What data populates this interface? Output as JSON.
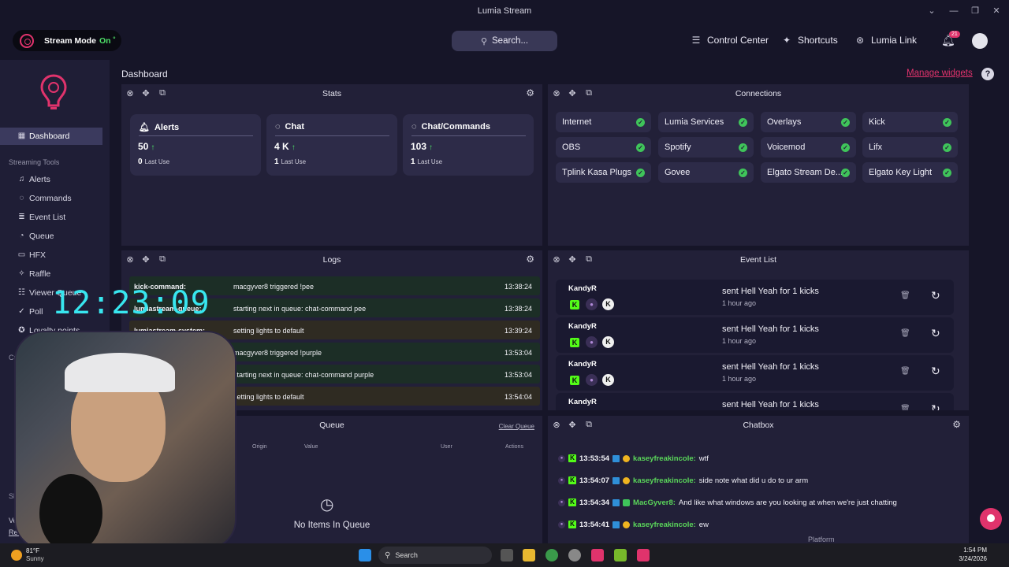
{
  "window": {
    "title": "Lumia Stream"
  },
  "topbar": {
    "stream_mode_label": "Stream Mode",
    "stream_mode_state": "On ˚",
    "search_placeholder": "Search...",
    "nav": [
      {
        "label": "Control Center",
        "icon": "sliders-icon"
      },
      {
        "label": "Shortcuts",
        "icon": "lightbulb-icon"
      },
      {
        "label": "Lumia Link",
        "icon": "link-icon"
      }
    ],
    "notifications_count": "21"
  },
  "sidebar": {
    "active": "Dashboard",
    "dashboard_label": "Dashboard",
    "section_streaming": "Streaming Tools",
    "items": [
      "Alerts",
      "Commands",
      "Event List",
      "Queue",
      "HFX",
      "Raffle",
      "Viewer Queue",
      "Poll",
      "Loyalty points"
    ],
    "section_creator": "Creator",
    "share_label": "Shar",
    "version_label": "Version:",
    "release_notes": "Release notes"
  },
  "main": {
    "title": "Dashboard",
    "manage_widgets": "Manage widgets",
    "help": "?"
  },
  "stats": {
    "title": "Stats",
    "cards": [
      {
        "name": "Alerts",
        "value": "50",
        "last_use_value": "0",
        "last_use_label": "Last Use"
      },
      {
        "name": "Chat",
        "value": "4 K",
        "last_use_value": "1",
        "last_use_label": "Last Use"
      },
      {
        "name": "Chat/Commands",
        "value": "103",
        "last_use_value": "1",
        "last_use_label": "Last Use"
      }
    ]
  },
  "connections": {
    "title": "Connections",
    "items": [
      "Internet",
      "Lumia Services",
      "Overlays",
      "Kick",
      "OBS",
      "Spotify",
      "Voicemod",
      "Lifx",
      "Tplink Kasa Plugs",
      "Govee",
      "Elgato Stream De...",
      "Elgato Key Light"
    ]
  },
  "logs": {
    "title": "Logs",
    "rows": [
      {
        "source": "kick-command:",
        "message": "macgyver8 triggered !pee",
        "time": "13:38:24",
        "tone": "g"
      },
      {
        "source": "lumiastream-queue:",
        "message": "starting next in queue: chat-command pee",
        "time": "13:38:24",
        "tone": "g"
      },
      {
        "source": "lumiastream-system:",
        "message": "setting lights to default",
        "time": "13:39:24",
        "tone": "y"
      },
      {
        "source": "",
        "message": "macgyver8 triggered !purple",
        "time": "13:53:04",
        "tone": "g"
      },
      {
        "source": "",
        "message": "starting next in queue: chat-command purple",
        "time": "13:53:04",
        "tone": "g"
      },
      {
        "source": "",
        "message": "setting lights to default",
        "time": "13:54:04",
        "tone": "y"
      }
    ]
  },
  "eventlist": {
    "title": "Event List",
    "rows": [
      {
        "user": "KandyR",
        "action": "sent Hell Yeah for 1 kicks",
        "ago": "1 hour ago"
      },
      {
        "user": "KandyR",
        "action": "sent Hell Yeah for 1 kicks",
        "ago": "1 hour ago"
      },
      {
        "user": "KandyR",
        "action": "sent Hell Yeah for 1 kicks",
        "ago": "1 hour ago"
      },
      {
        "user": "KandyR",
        "action": "sent Hell Yeah for 1 kicks",
        "ago": ""
      }
    ]
  },
  "queue": {
    "title": "Queue",
    "clear": "Clear Queue",
    "columns": [
      "Origin",
      "Value",
      "User",
      "Actions"
    ],
    "empty": "No Items In Queue"
  },
  "chatbox": {
    "title": "Chatbox",
    "rows": [
      {
        "time": "13:53:54",
        "name": "kaseyfreakincole:",
        "text": "wtf",
        "badge": "b2"
      },
      {
        "time": "13:54:07",
        "name": "kaseyfreakincole:",
        "text": "side note what did u do to ur arm",
        "badge": "b2"
      },
      {
        "time": "13:54:34",
        "name": "MacGyver8:",
        "text": "And like what windows are you looking at when we're just chatting",
        "badge": "b3"
      },
      {
        "time": "13:54:41",
        "name": "kaseyfreakincole:",
        "text": "ew",
        "badge": "b2"
      }
    ],
    "platform_label": "Platform"
  },
  "overlay": {
    "clock": "12:23:09"
  },
  "taskbar": {
    "weather_temp": "81°F",
    "weather_desc": "Sunny",
    "search": "Search",
    "time": "1:54 PM",
    "date": "3/24/2026"
  },
  "colors": {
    "accent": "#e0336c",
    "ok": "#3fc45a",
    "kick": "#53fc18",
    "bg": "#161528",
    "panel": "#222038"
  }
}
